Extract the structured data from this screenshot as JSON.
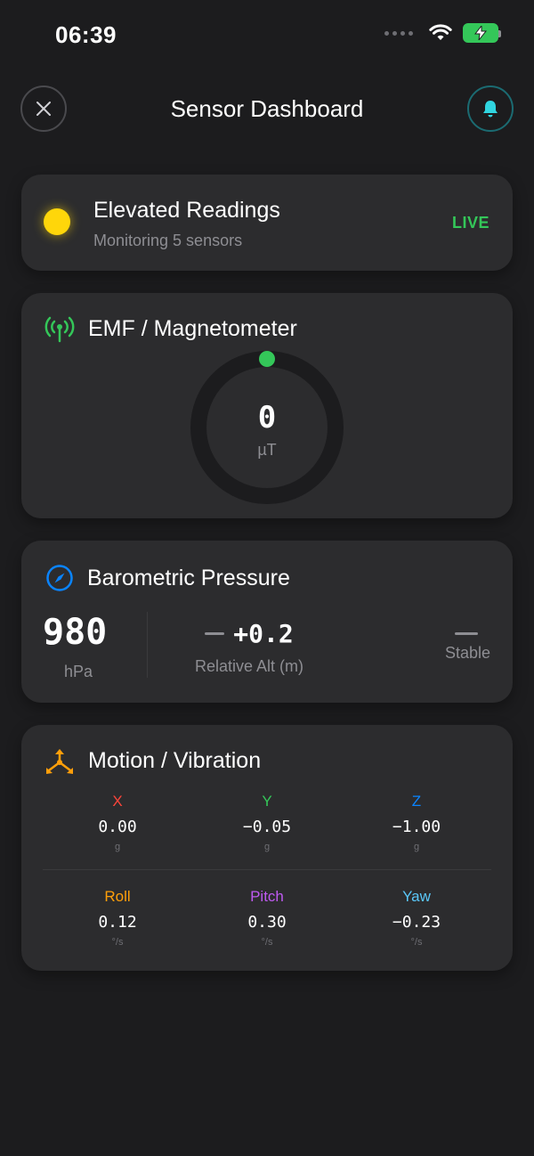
{
  "status_bar": {
    "time": "06:39"
  },
  "nav": {
    "title": "Sensor Dashboard"
  },
  "status_card": {
    "title": "Elevated Readings",
    "subtitle": "Monitoring 5 sensors",
    "badge": "LIVE",
    "indicator_color": "#ffd60a"
  },
  "emf": {
    "title": "EMF / Magnetometer",
    "value": "0",
    "unit": "µT",
    "gauge_level": 0,
    "accent": "#34c759"
  },
  "barometer": {
    "title": "Barometric Pressure",
    "pressure": "980",
    "pressure_unit": "hPa",
    "altitude": "+0.2",
    "altitude_label": "Relative Alt (m)",
    "trend": "Stable",
    "accent": "#0a84ff"
  },
  "motion": {
    "title": "Motion / Vibration",
    "accent": "#ff9f0a",
    "accel": [
      {
        "label": "X",
        "value": "0.00",
        "unit": "g",
        "color": "#ff453a"
      },
      {
        "label": "Y",
        "value": "−0.05",
        "unit": "g",
        "color": "#34c759"
      },
      {
        "label": "Z",
        "value": "−1.00",
        "unit": "g",
        "color": "#0a84ff"
      }
    ],
    "gyro": [
      {
        "label": "Roll",
        "value": "0.12",
        "unit": "°/s",
        "color": "#ff9f0a"
      },
      {
        "label": "Pitch",
        "value": "0.30",
        "unit": "°/s",
        "color": "#bf5af2"
      },
      {
        "label": "Yaw",
        "value": "−0.23",
        "unit": "°/s",
        "color": "#5ac8fa"
      }
    ]
  }
}
